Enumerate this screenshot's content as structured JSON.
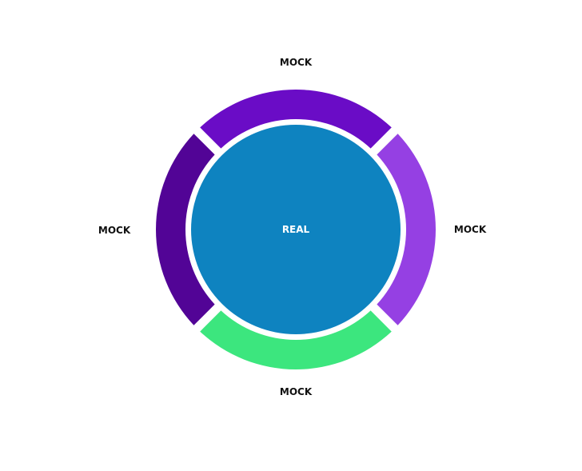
{
  "diagram": {
    "center": {
      "label": "REAL",
      "color": "#0e83c0"
    },
    "segments": [
      {
        "position": "top",
        "label": "MOCK",
        "color": "#6a0cc6"
      },
      {
        "position": "right",
        "label": "MOCK",
        "color": "#9540e3"
      },
      {
        "position": "bottom",
        "label": "MOCK",
        "color": "#3ce67e"
      },
      {
        "position": "left",
        "label": "MOCK",
        "color": "#520496"
      }
    ]
  }
}
